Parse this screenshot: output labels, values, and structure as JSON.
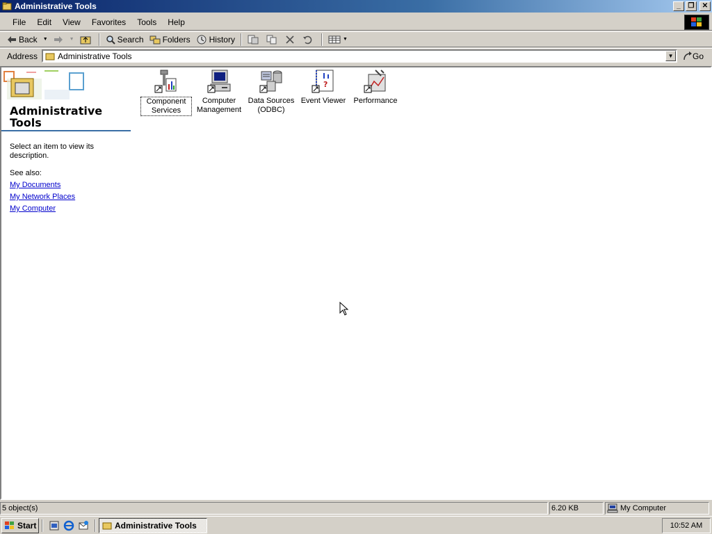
{
  "window": {
    "title": "Administrative Tools"
  },
  "menu": [
    "File",
    "Edit",
    "View",
    "Favorites",
    "Tools",
    "Help"
  ],
  "toolbar": {
    "back": "Back",
    "search": "Search",
    "folders": "Folders",
    "history": "History"
  },
  "address": {
    "label": "Address",
    "value": "Administrative Tools",
    "go": "Go"
  },
  "leftpane": {
    "title": "Administrative Tools",
    "description": "Select an item to view its description.",
    "see_also": "See also:",
    "links": [
      "My Documents",
      "My Network Places",
      "My Computer"
    ]
  },
  "items": [
    {
      "label": "Component Services",
      "icon": "component-services-icon"
    },
    {
      "label": "Computer Management",
      "icon": "computer-management-icon"
    },
    {
      "label": "Data Sources (ODBC)",
      "icon": "odbc-icon"
    },
    {
      "label": "Event Viewer",
      "icon": "event-viewer-icon"
    },
    {
      "label": "Performance",
      "icon": "performance-icon"
    }
  ],
  "status": {
    "objects": "5 object(s)",
    "size": "6.20 KB",
    "zone": "My Computer"
  },
  "taskbar": {
    "start": "Start",
    "task": "Administrative Tools",
    "clock": "10:52 AM"
  }
}
